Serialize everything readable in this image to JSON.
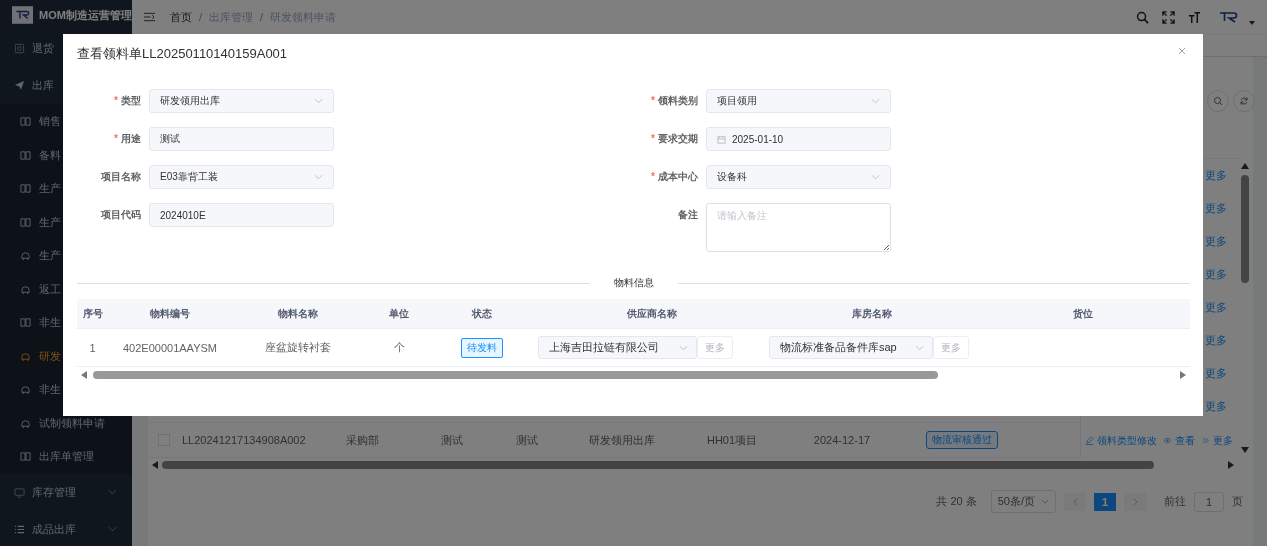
{
  "sidebar": {
    "title": "MOM制造运营管理",
    "items": [
      {
        "label": "退货"
      },
      {
        "label": "出库",
        "children": [
          {
            "label": "销售",
            "kind": "book",
            "selected": false
          },
          {
            "label": "备料",
            "kind": "book",
            "selected": false
          },
          {
            "label": "生产",
            "kind": "book",
            "selected": false
          },
          {
            "label": "生产",
            "kind": "book",
            "selected": false
          },
          {
            "label": "生产",
            "kind": "person",
            "selected": false
          },
          {
            "label": "返工",
            "kind": "person",
            "selected": false
          },
          {
            "label": "非生",
            "kind": "book",
            "selected": false
          },
          {
            "label": "研发",
            "kind": "person",
            "selected": true
          },
          {
            "label": "非生",
            "kind": "person",
            "selected": false
          },
          {
            "label": "试制领料申请",
            "kind": "person",
            "selected": false
          },
          {
            "label": "出库单管理",
            "kind": "book",
            "selected": false
          }
        ]
      },
      {
        "label": "库存管理",
        "expanded": false
      },
      {
        "label": "成品出库",
        "expanded": false
      }
    ]
  },
  "breadcrumb": [
    "首页",
    "出库管理",
    "研发领料申请"
  ],
  "breadcrumb_separators": [
    "/",
    "/"
  ],
  "list": {
    "row_links": [
      "更多",
      "更多",
      "更多",
      "更多",
      "更多",
      "更多",
      "更多",
      "更多"
    ],
    "last_row": {
      "checked": false,
      "cells": [
        "LL20241217134908A002",
        "采购部",
        "测试",
        "测试",
        "研发领用出库",
        "HH01项目",
        "2024-12-17"
      ],
      "status": "物流审核通过",
      "actions": [
        "领料类型修改",
        "查看",
        "更多"
      ]
    }
  },
  "pagination": {
    "total": "共 20 条",
    "page_size": "50条/页",
    "pages": [
      {
        "label": "1",
        "selected": true
      }
    ],
    "goto_label": "前往",
    "goto_value": "1",
    "goto_unit": "页"
  },
  "dialog": {
    "title": "查看领料单LL20250110140159A001",
    "fields_left": [
      {
        "label": "类型",
        "required_mark": "*",
        "kind": "select",
        "value": "研发领用出库"
      },
      {
        "label": "用途",
        "required_mark": "*",
        "kind": "input",
        "value": "测试"
      },
      {
        "label": "项目名称",
        "kind": "select",
        "value": "E03靠背工装"
      },
      {
        "label": "项目代码",
        "kind": "input",
        "value": "2024010E"
      }
    ],
    "fields_right": [
      {
        "label": "领料类别",
        "required_mark": "*",
        "kind": "select",
        "value": "项目领用"
      },
      {
        "label": "要求交期",
        "required_mark": "*",
        "kind": "date",
        "value": "2025-01-10"
      },
      {
        "label": "成本中心",
        "required_mark": "*",
        "kind": "select",
        "value": "设备科"
      },
      {
        "label": "备注",
        "kind": "textarea",
        "placeholder": "请输入备注"
      }
    ],
    "section": "物料信息",
    "columns": [
      "序号",
      "物料编号",
      "物料名称",
      "单位",
      "状态",
      "供应商名称",
      "库房名称",
      "货位"
    ],
    "rows": [
      {
        "index": "1",
        "code": "402E00001AAYSM",
        "name": "座盆旋转衬套",
        "unit": "个",
        "status": "待发料",
        "supplier": "上海吉田拉链有限公司",
        "supplier_more": "更多",
        "warehouse": "物流标准备品备件库sap",
        "warehouse_more": "更多"
      }
    ]
  }
}
